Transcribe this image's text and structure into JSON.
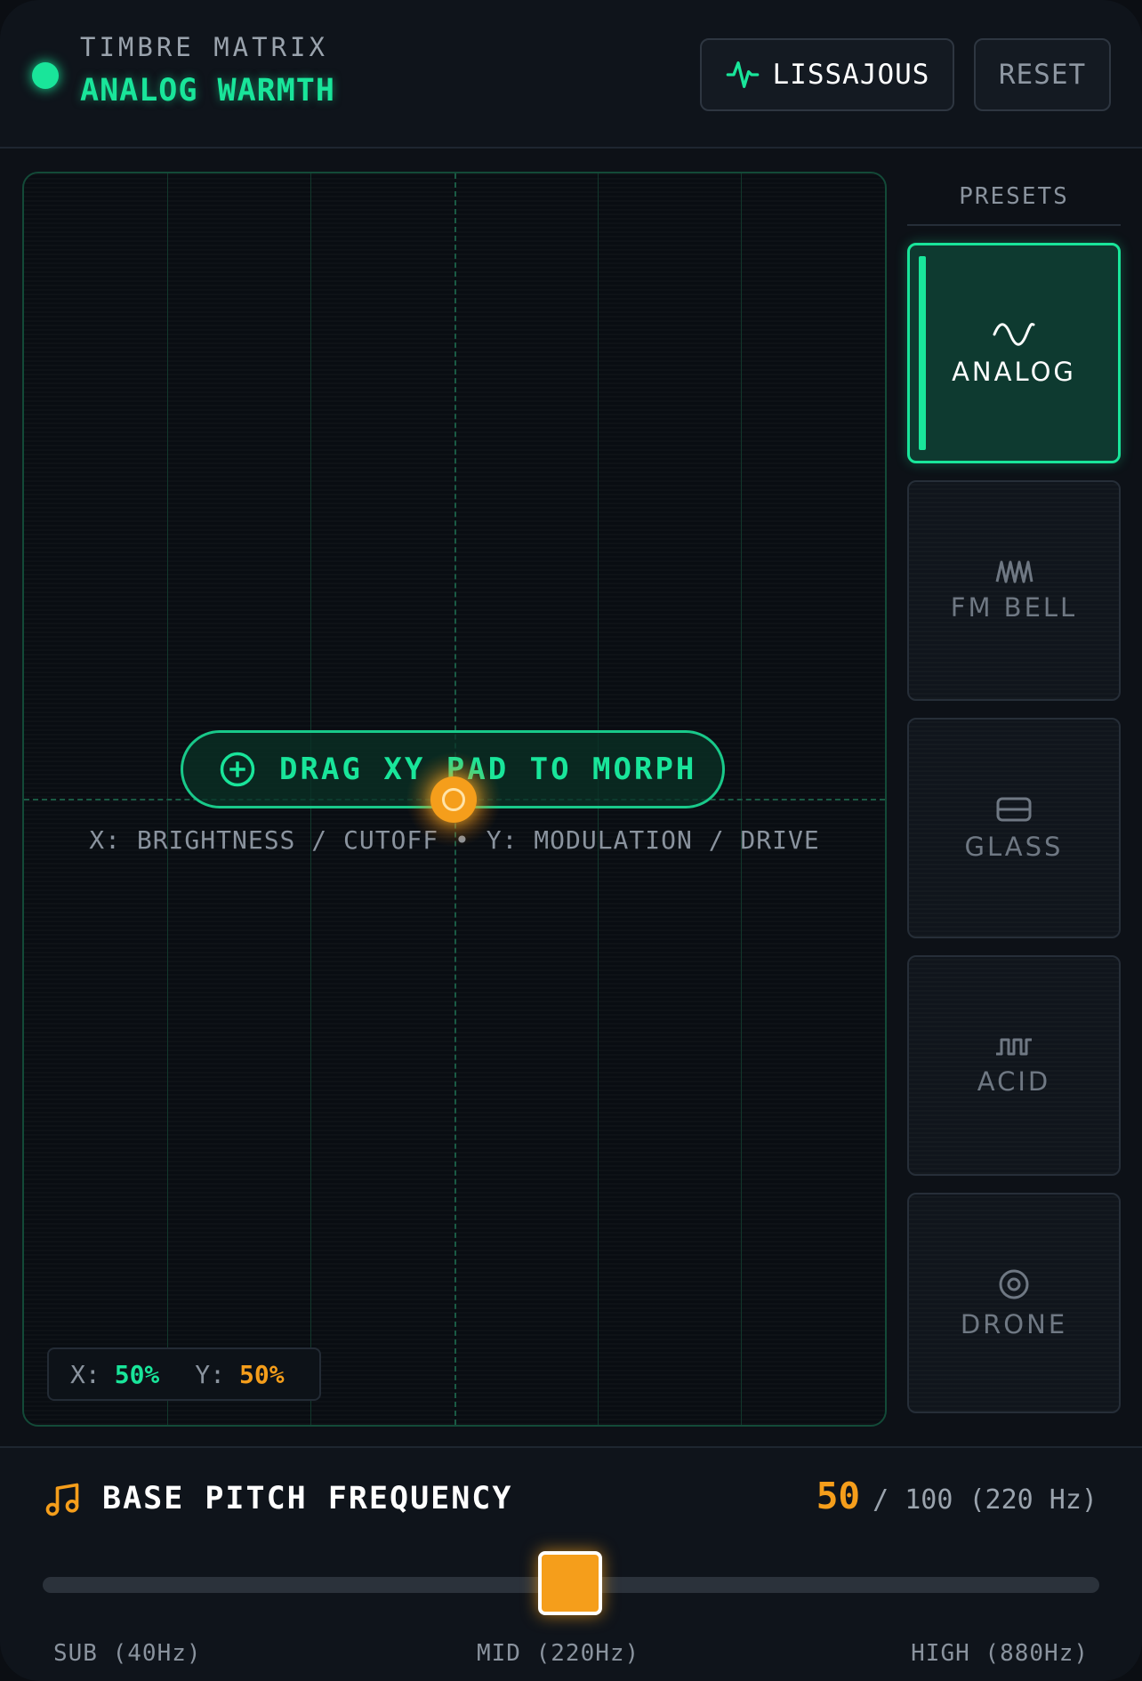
{
  "header": {
    "subtitle": "TIMBRE MATRIX",
    "title": "ANALOG WARMTH",
    "lissajous_label": "LISSAJOUS",
    "reset_label": "RESET",
    "accent": "#19e59a"
  },
  "pad": {
    "hint": "DRAG XY PAD TO MORPH",
    "axes_text": "X: BRIGHTNESS / CUTOFF • Y: MODULATION / DRIVE",
    "x_label": "X:",
    "x_value": "50%",
    "y_label": "Y:",
    "y_value": "50%",
    "cursor_color": "#f59e1b"
  },
  "presets": {
    "title": "PRESETS",
    "items": [
      {
        "label": "ANALOG",
        "icon": "sine-wave-icon",
        "active": true
      },
      {
        "label": "FM BELL",
        "icon": "zigzag-wave-icon",
        "active": false
      },
      {
        "label": "GLASS",
        "icon": "glass-pane-icon",
        "active": false
      },
      {
        "label": "ACID",
        "icon": "square-wave-icon",
        "active": false
      },
      {
        "label": "DRONE",
        "icon": "concentric-circle-icon",
        "active": false
      }
    ]
  },
  "pitch": {
    "title": "BASE PITCH FREQUENCY",
    "icon": "music-note-icon",
    "value": "50",
    "rest": "/ 100 (220 Hz)",
    "slider_value": 50,
    "slider_max": 100,
    "ticks": [
      "SUB (40Hz)",
      "MID (220Hz)",
      "HIGH (880Hz)"
    ]
  }
}
